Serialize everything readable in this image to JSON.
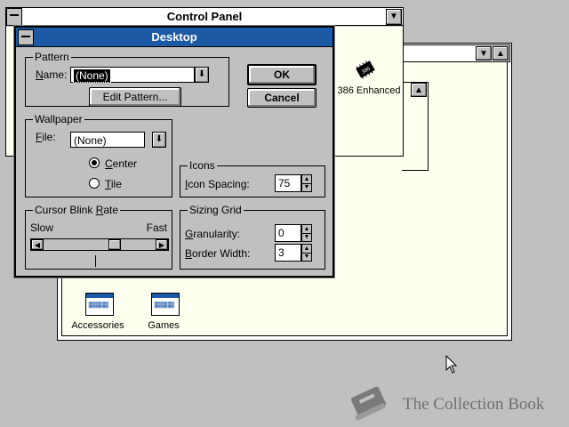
{
  "control_panel": {
    "title": "Control Panel",
    "icon_386_label": "386 Enhanced"
  },
  "program_group": {
    "icons": [
      {
        "label": "Accessories"
      },
      {
        "label": "Games"
      }
    ]
  },
  "dialog": {
    "title": "Desktop",
    "pattern": {
      "group_label": "Pattern",
      "name_label_prefix": "",
      "name_label_u": "N",
      "name_label_rest": "ame:",
      "value": "(None)",
      "edit_button": "Edit Pattern..."
    },
    "wallpaper": {
      "group_label": "Wallpaper",
      "file_label_u": "F",
      "file_label_rest": "ile:",
      "value": "(None)",
      "center_u": "C",
      "center_rest": "enter",
      "tile_u": "T",
      "tile_rest": "ile",
      "selected": "Center"
    },
    "cursor_blink": {
      "group_label_pre": "Cursor Blink ",
      "group_label_u": "R",
      "group_label_rest": "ate",
      "slow": "Slow",
      "fast": "Fast",
      "rate_fraction": 0.65
    },
    "icons": {
      "group_label": "Icons",
      "spacing_label_u": "I",
      "spacing_label_rest": "con Spacing:",
      "spacing_value": "75"
    },
    "sizing_grid": {
      "group_label": "Sizing Grid",
      "granularity_label_u": "G",
      "granularity_label_rest": "ranularity:",
      "granularity_value": "0",
      "border_label_u": "B",
      "border_label_rest": "order Width:",
      "border_value": "3"
    },
    "ok_button": "OK",
    "cancel_button": "Cancel"
  },
  "watermark": {
    "text": "The Collection Book"
  }
}
